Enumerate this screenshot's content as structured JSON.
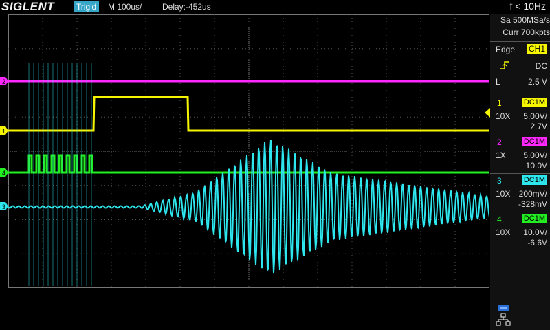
{
  "header": {
    "brand": "SIGLENT",
    "trigger_status": "Trig'd",
    "timebase": "M 100us/",
    "delay": "Delay:-452us",
    "frequency": "f < 10Hz"
  },
  "acquisition": {
    "sample_rate": "Sa 500MSa/s",
    "memory": "Curr 700kpts"
  },
  "trigger": {
    "type": "Edge",
    "source": "CH1",
    "coupling": "DC",
    "slope_icon": "rising-edge-icon",
    "level_label": "L",
    "level_value": "2.5 V"
  },
  "channels": [
    {
      "num": "1",
      "coupling": "DC1M",
      "probe": "10X",
      "scale": "5.00V/",
      "offset": "2.7V",
      "color": "#f5f500"
    },
    {
      "num": "2",
      "coupling": "DC1M",
      "probe": "1X",
      "scale": "5.00V/",
      "offset": "10.0V",
      "color": "#ff28ff"
    },
    {
      "num": "3",
      "coupling": "DC1M",
      "probe": "10X",
      "scale": "200mV/",
      "offset": "-328mV",
      "color": "#2ee6ee"
    },
    {
      "num": "4",
      "coupling": "DC1M",
      "probe": "10X",
      "scale": "10.0V/",
      "offset": "-6.6V",
      "color": "#22ee22"
    }
  ],
  "markers": {
    "ch1": "1",
    "ch2": "2",
    "ch3": "3",
    "ch4": "4"
  },
  "status_icons": [
    "usb-icon",
    "network-icon"
  ]
}
